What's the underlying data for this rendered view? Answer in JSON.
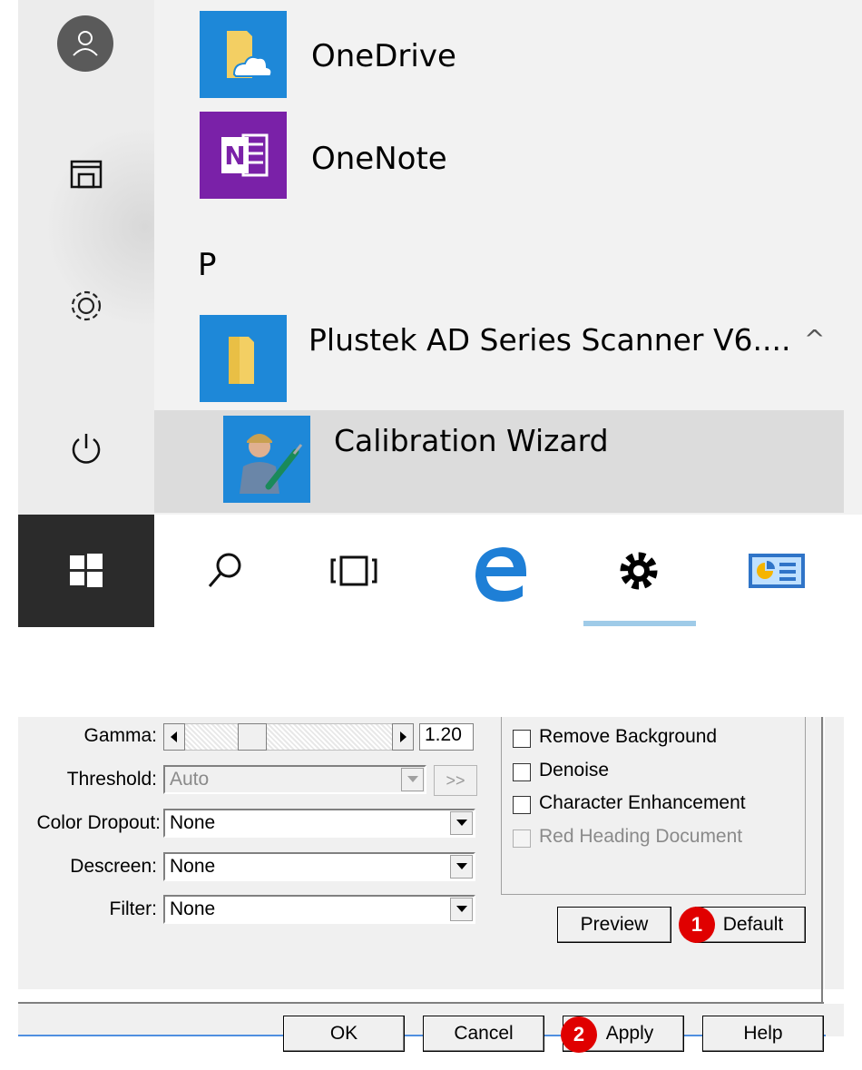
{
  "start_menu": {
    "rail": {
      "account": "account-icon",
      "documents": "documents-icon",
      "settings": "settings-gear-icon",
      "power": "power-icon"
    },
    "apps": [
      {
        "label": "OneDrive",
        "icon": "onedrive-icon",
        "tile_color": "#1e88d8"
      },
      {
        "label": "OneNote",
        "icon": "onenote-icon",
        "tile_color": "#7a21a8"
      }
    ],
    "section_letter": "P",
    "folder": {
      "label": "Plustek AD Series Scanner V6....",
      "icon": "folder-icon",
      "chevron": "^"
    },
    "sub_app": {
      "label": "Calibration Wizard",
      "icon": "calibration-wizard-icon"
    }
  },
  "taskbar": {
    "start": "windows-start-icon",
    "search": "search-icon",
    "task_view": "task-view-icon",
    "edge": "edge-browser-icon",
    "settings": "settings-gear-icon",
    "control_panel": "control-panel-icon",
    "active_item": "settings"
  },
  "dialog": {
    "gamma": {
      "label": "Gamma:",
      "value": "1.20"
    },
    "threshold": {
      "label": "Threshold:",
      "value": "Auto",
      "more": ">>"
    },
    "color_dropout": {
      "label": "Color Dropout:",
      "value": "None"
    },
    "descreen": {
      "label": "Descreen:",
      "value": "None"
    },
    "filter": {
      "label": "Filter:",
      "value": "None"
    },
    "options": [
      {
        "label": "Remove Background",
        "checked": false,
        "disabled": false
      },
      {
        "label": "Denoise",
        "checked": false,
        "disabled": false
      },
      {
        "label": "Character Enhancement",
        "checked": false,
        "disabled": false
      },
      {
        "label": "Red Heading Document",
        "checked": false,
        "disabled": true
      }
    ],
    "preview_label": "Preview",
    "default_label": "Default",
    "ok_label": "OK",
    "cancel_label": "Cancel",
    "apply_label": "Apply",
    "help_label": "Help",
    "badges": {
      "one": "1",
      "two": "2"
    }
  }
}
